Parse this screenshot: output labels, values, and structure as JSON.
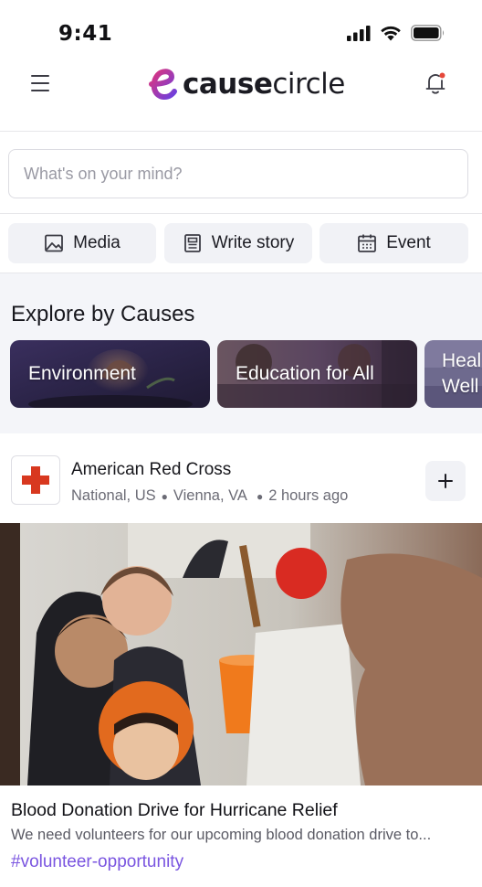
{
  "status_bar": {
    "time": "9:41"
  },
  "header": {
    "logo_word_bold": "cause",
    "logo_word_light": "circle",
    "menu_icon": "hamburger-icon",
    "notification_icon": "bell-icon"
  },
  "composer": {
    "placeholder": "What's on your mind?",
    "value": ""
  },
  "actions": [
    {
      "label": "Media",
      "icon": "image-icon"
    },
    {
      "label": "Write story",
      "icon": "document-icon"
    },
    {
      "label": "Event",
      "icon": "calendar-icon"
    }
  ],
  "explore": {
    "title": "Explore by Causes",
    "causes": [
      {
        "label": "Environment"
      },
      {
        "label": "Education for All"
      },
      {
        "label": "Heal Well"
      }
    ]
  },
  "post": {
    "org_name": "American Red Cross",
    "scope": "National, US",
    "location": "Vienna, VA",
    "time_ago": "2 hours ago",
    "title": "Blood Donation Drive for Hurricane Relief",
    "excerpt": "We need volunteers for our upcoming blood donation drive to...",
    "tag": "#volunteer-opportunity"
  },
  "colors": {
    "accent": "#7a55e0",
    "logo_gradient_start": "#e0347c",
    "logo_gradient_end": "#6a3fe0",
    "red_cross": "#d8381f",
    "button_bg": "#f1f2f6",
    "notification_dot": "#e5483a"
  }
}
